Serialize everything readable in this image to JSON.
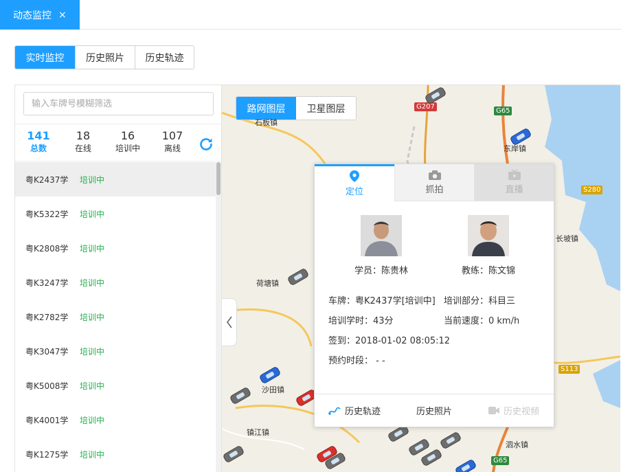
{
  "top_tab": {
    "label": "动态监控",
    "close": "×"
  },
  "mode_buttons": [
    "实时监控",
    "历史照片",
    "历史轨迹"
  ],
  "search": {
    "placeholder": "输入车牌号模糊筛选",
    "value": ""
  },
  "stats": [
    {
      "value": "141",
      "label": "总数"
    },
    {
      "value": "18",
      "label": "在线"
    },
    {
      "value": "16",
      "label": "培训中"
    },
    {
      "value": "107",
      "label": "离线"
    }
  ],
  "vehicles": [
    {
      "plate": "粤K2437学",
      "status": "培训中"
    },
    {
      "plate": "粤K5322学",
      "status": "培训中"
    },
    {
      "plate": "粤K2808学",
      "status": "培训中"
    },
    {
      "plate": "粤K3247学",
      "status": "培训中"
    },
    {
      "plate": "粤K2782学",
      "status": "培训中"
    },
    {
      "plate": "粤K3047学",
      "status": "培训中"
    },
    {
      "plate": "粤K5008学",
      "status": "培训中"
    },
    {
      "plate": "粤K4001学",
      "status": "培训中"
    },
    {
      "plate": "粤K1275学",
      "status": "培训中"
    }
  ],
  "map_layers": [
    "路网图层",
    "卫星图层"
  ],
  "map_labels": {
    "towns": [
      "石板镇",
      "东岸镇",
      "长坡镇",
      "荷塘镇",
      "沙田镇",
      "镇江镇",
      "泗水镇"
    ],
    "roads": [
      "G207",
      "G65",
      "S280",
      "S113",
      "G65"
    ]
  },
  "popup": {
    "tabs": [
      "定位",
      "抓拍",
      "直播"
    ],
    "student": "学员：陈贵林",
    "coach": "教练：陈文锦",
    "plate_line": "车牌：粤K2437学[培训中]",
    "section_line": "培训部分：科目三",
    "hours_line": "培训学时：43分",
    "speed_line": "当前速度：0 km/h",
    "checkin_line": "签到：2018-01-02 08:05:12",
    "booking_line": "预约时段： - -",
    "footer": [
      "历史轨迹",
      "历史照片",
      "历史视频"
    ]
  },
  "colors": {
    "accent": "#1e9fff",
    "status_green": "#22b14c"
  }
}
